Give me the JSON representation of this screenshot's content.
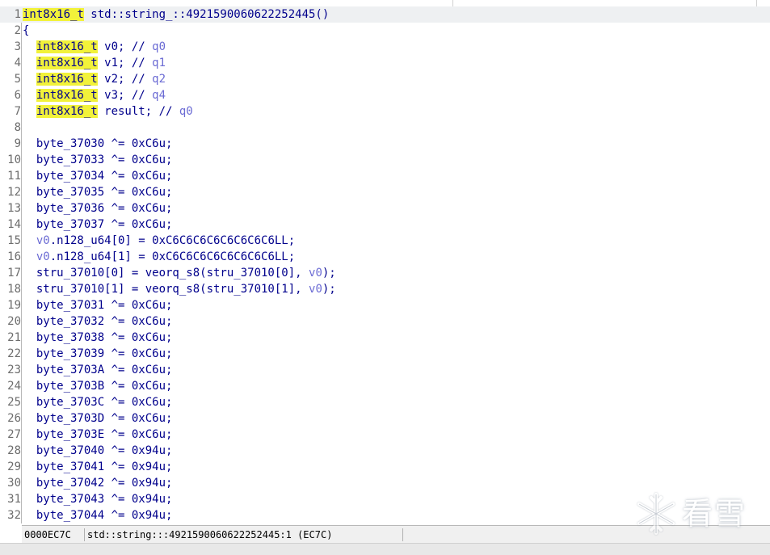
{
  "status_bar": {
    "address": "0000EC7C",
    "location": "std::string:::4921590060622252445:1 (EC7C)"
  },
  "watermark": {
    "text": "看雪",
    "logo": "snowflake-logo"
  },
  "colors": {
    "type_highlight": "#f2f23a",
    "code_text": "#00008c",
    "variable": "#6b6bd4",
    "gutter_border": "#b8b8b8"
  },
  "lines": [
    {
      "n": "1",
      "tokens": [
        {
          "t": "int8x16_t",
          "k": "hl"
        },
        {
          "t": " std::string_::4921590060622252445()",
          "k": "p"
        }
      ]
    },
    {
      "n": "2",
      "tokens": [
        {
          "t": "{",
          "k": "p"
        }
      ]
    },
    {
      "n": "3",
      "tokens": [
        {
          "t": "  ",
          "k": "p"
        },
        {
          "t": "int8x16_t",
          "k": "hl"
        },
        {
          "t": " v0; // ",
          "k": "p"
        },
        {
          "t": "q0",
          "k": "v"
        }
      ]
    },
    {
      "n": "4",
      "tokens": [
        {
          "t": "  ",
          "k": "p"
        },
        {
          "t": "int8x16_t",
          "k": "hl"
        },
        {
          "t": " v1; // ",
          "k": "p"
        },
        {
          "t": "q1",
          "k": "v"
        }
      ]
    },
    {
      "n": "5",
      "tokens": [
        {
          "t": "  ",
          "k": "p"
        },
        {
          "t": "int8x16_t",
          "k": "hl"
        },
        {
          "t": " v2; // ",
          "k": "p"
        },
        {
          "t": "q2",
          "k": "v"
        }
      ]
    },
    {
      "n": "6",
      "tokens": [
        {
          "t": "  ",
          "k": "p"
        },
        {
          "t": "int8x16_t",
          "k": "hl"
        },
        {
          "t": " v3; // ",
          "k": "p"
        },
        {
          "t": "q4",
          "k": "v"
        }
      ]
    },
    {
      "n": "7",
      "tokens": [
        {
          "t": "  ",
          "k": "p"
        },
        {
          "t": "int8x16_t",
          "k": "hl"
        },
        {
          "t": " result; // ",
          "k": "p"
        },
        {
          "t": "q0",
          "k": "v"
        }
      ]
    },
    {
      "n": "8",
      "tokens": []
    },
    {
      "n": "9",
      "tokens": [
        {
          "t": "  byte_37030 ^= 0xC6u;",
          "k": "p"
        }
      ]
    },
    {
      "n": "10",
      "tokens": [
        {
          "t": "  byte_37033 ^= 0xC6u;",
          "k": "p"
        }
      ]
    },
    {
      "n": "11",
      "tokens": [
        {
          "t": "  byte_37034 ^= 0xC6u;",
          "k": "p"
        }
      ]
    },
    {
      "n": "12",
      "tokens": [
        {
          "t": "  byte_37035 ^= 0xC6u;",
          "k": "p"
        }
      ]
    },
    {
      "n": "13",
      "tokens": [
        {
          "t": "  byte_37036 ^= 0xC6u;",
          "k": "p"
        }
      ]
    },
    {
      "n": "14",
      "tokens": [
        {
          "t": "  byte_37037 ^= 0xC6u;",
          "k": "p"
        }
      ]
    },
    {
      "n": "15",
      "tokens": [
        {
          "t": "  ",
          "k": "p"
        },
        {
          "t": "v0",
          "k": "v"
        },
        {
          "t": ".n128_u64[0] = 0xC6C6C6C6C6C6C6C6LL;",
          "k": "p"
        }
      ]
    },
    {
      "n": "16",
      "tokens": [
        {
          "t": "  ",
          "k": "p"
        },
        {
          "t": "v0",
          "k": "v"
        },
        {
          "t": ".n128_u64[1] = 0xC6C6C6C6C6C6C6C6LL;",
          "k": "p"
        }
      ]
    },
    {
      "n": "17",
      "tokens": [
        {
          "t": "  stru_37010[0] = veorq_s8(stru_37010[0], ",
          "k": "p"
        },
        {
          "t": "v0",
          "k": "v"
        },
        {
          "t": ");",
          "k": "p"
        }
      ]
    },
    {
      "n": "18",
      "tokens": [
        {
          "t": "  stru_37010[1] = veorq_s8(stru_37010[1], ",
          "k": "p"
        },
        {
          "t": "v0",
          "k": "v"
        },
        {
          "t": ");",
          "k": "p"
        }
      ]
    },
    {
      "n": "19",
      "tokens": [
        {
          "t": "  byte_37031 ^= 0xC6u;",
          "k": "p"
        }
      ]
    },
    {
      "n": "20",
      "tokens": [
        {
          "t": "  byte_37032 ^= 0xC6u;",
          "k": "p"
        }
      ]
    },
    {
      "n": "21",
      "tokens": [
        {
          "t": "  byte_37038 ^= 0xC6u;",
          "k": "p"
        }
      ]
    },
    {
      "n": "22",
      "tokens": [
        {
          "t": "  byte_37039 ^= 0xC6u;",
          "k": "p"
        }
      ]
    },
    {
      "n": "23",
      "tokens": [
        {
          "t": "  byte_3703A ^= 0xC6u;",
          "k": "p"
        }
      ]
    },
    {
      "n": "24",
      "tokens": [
        {
          "t": "  byte_3703B ^= 0xC6u;",
          "k": "p"
        }
      ]
    },
    {
      "n": "25",
      "tokens": [
        {
          "t": "  byte_3703C ^= 0xC6u;",
          "k": "p"
        }
      ]
    },
    {
      "n": "26",
      "tokens": [
        {
          "t": "  byte_3703D ^= 0xC6u;",
          "k": "p"
        }
      ]
    },
    {
      "n": "27",
      "tokens": [
        {
          "t": "  byte_3703E ^= 0xC6u;",
          "k": "p"
        }
      ]
    },
    {
      "n": "28",
      "tokens": [
        {
          "t": "  byte_37040 ^= 0x94u;",
          "k": "p"
        }
      ]
    },
    {
      "n": "29",
      "tokens": [
        {
          "t": "  byte_37041 ^= 0x94u;",
          "k": "p"
        }
      ]
    },
    {
      "n": "30",
      "tokens": [
        {
          "t": "  byte_37042 ^= 0x94u;",
          "k": "p"
        }
      ]
    },
    {
      "n": "31",
      "tokens": [
        {
          "t": "  byte_37043 ^= 0x94u;",
          "k": "p"
        }
      ]
    },
    {
      "n": "32",
      "tokens": [
        {
          "t": "  byte_37044 ^= 0x94u;",
          "k": "p"
        }
      ]
    }
  ]
}
